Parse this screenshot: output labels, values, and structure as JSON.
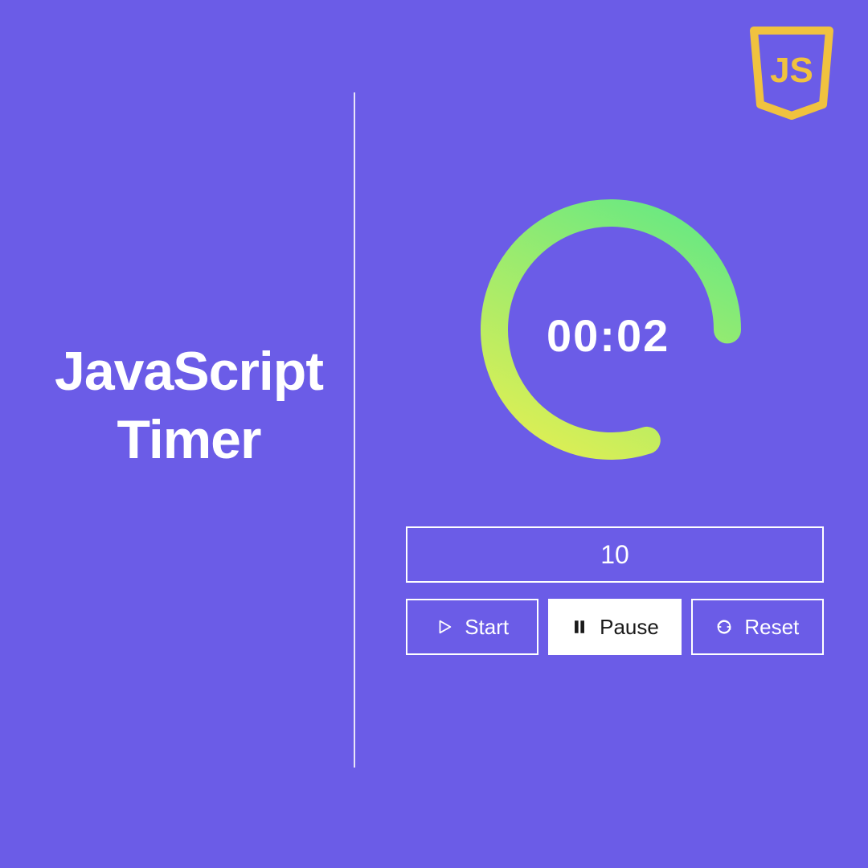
{
  "title": {
    "line1": "JavaScript",
    "line2": "Timer"
  },
  "timer": {
    "display": "00:02",
    "progress_percent": 80
  },
  "input": {
    "value": "10"
  },
  "buttons": {
    "start": "Start",
    "pause": "Pause",
    "reset": "Reset",
    "active": "pause"
  },
  "colors": {
    "background": "#6B5CE7",
    "accent_yellow": "#F0C23F",
    "ring_gradient_start": "#E8EF50",
    "ring_gradient_end": "#5FE886"
  }
}
